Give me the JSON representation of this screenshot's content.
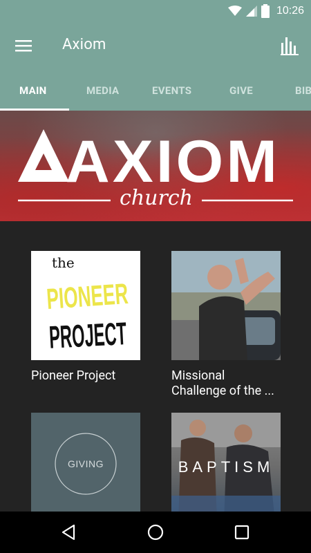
{
  "status": {
    "time": "10:26"
  },
  "app": {
    "title": "Axiom"
  },
  "tabs": [
    {
      "label": "MAIN"
    },
    {
      "label": "MEDIA"
    },
    {
      "label": "EVENTS"
    },
    {
      "label": "GIVE"
    },
    {
      "label": "BIB"
    }
  ],
  "banner": {
    "wordmark": "AXIOM",
    "subtitle": "church"
  },
  "cards": [
    {
      "title": "Pioneer Project",
      "thumb_text": [
        "the",
        "PIONEER",
        "PROJECT"
      ]
    },
    {
      "title": "Missional Challenge of the ..."
    },
    {
      "title": "",
      "thumb_text": "GIVING"
    },
    {
      "title": "",
      "thumb_text": "BAPTISM"
    }
  ],
  "colors": {
    "app_bar": "#7aa59a",
    "content_bg": "#232323",
    "nav_bar": "#000000"
  }
}
